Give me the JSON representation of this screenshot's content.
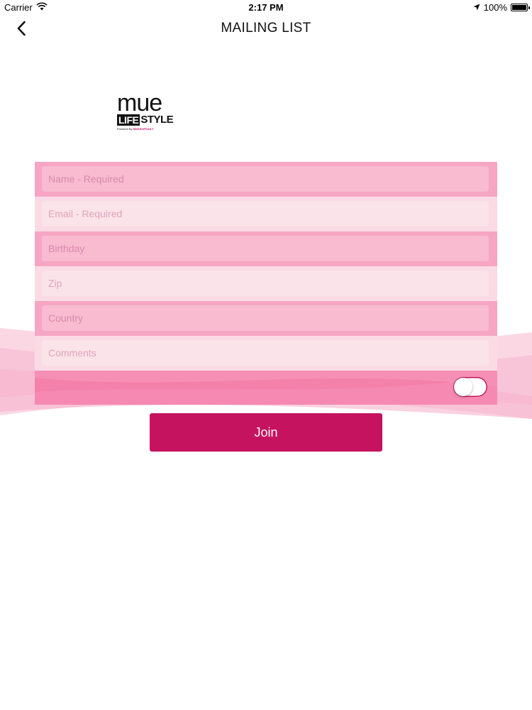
{
  "status_bar": {
    "carrier": "Carrier",
    "time": "2:17 PM",
    "battery": "100%",
    "battery_level": 1.0
  },
  "nav": {
    "title": "MAILING LIST",
    "back_icon": "chevron-left-icon"
  },
  "logo": {
    "line1": "mue",
    "life": "LIFE",
    "style": "STYLE",
    "powered": "Powered By",
    "brand": "MAKEUPDAILY"
  },
  "form": {
    "fields": [
      {
        "name": "name",
        "placeholder": "Name - Required",
        "value": ""
      },
      {
        "name": "email",
        "placeholder": "Email - Required",
        "value": ""
      },
      {
        "name": "birthday",
        "placeholder": "Birthday",
        "value": ""
      },
      {
        "name": "zip",
        "placeholder": "Zip",
        "value": ""
      },
      {
        "name": "country",
        "placeholder": "Country",
        "value": ""
      },
      {
        "name": "comments",
        "placeholder": "Comments",
        "value": ""
      }
    ],
    "toggle_on": false
  },
  "join_button": {
    "label": "Join"
  },
  "colors": {
    "accent": "#c5135f",
    "panel": "#f6a9c4",
    "wave": "#f8c6d8"
  }
}
